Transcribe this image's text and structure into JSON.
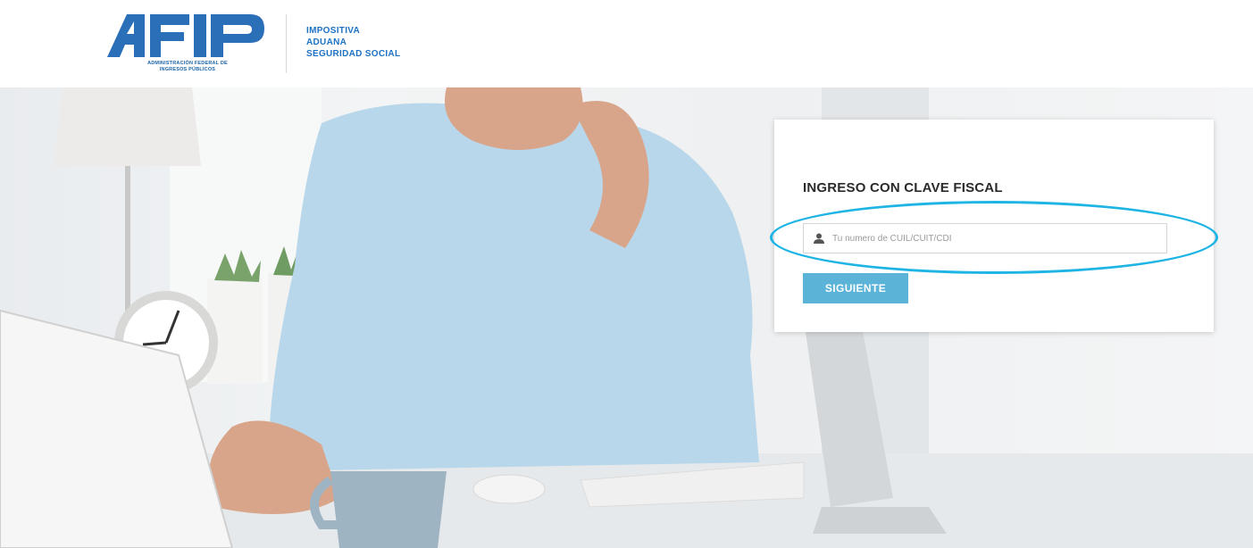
{
  "header": {
    "logo": {
      "wordmark": "AFIP",
      "caption_line1": "ADMINISTRACIÓN FEDERAL DE",
      "caption_line2": "INGRESOS PÚBLICOS"
    },
    "taxonomy": [
      "IMPOSITIVA",
      "ADUANA",
      "SEGURIDAD SOCIAL"
    ]
  },
  "login": {
    "title": "INGRESO CON CLAVE FISCAL",
    "cuit_placeholder": "Tu numero de CUIL/CUIT/CDI",
    "cuit_value": "",
    "next_label": "SIGUIENTE",
    "user_icon": "user-icon"
  },
  "colors": {
    "brand_blue": "#1e72c4",
    "button_blue": "#5bb4d8",
    "highlight": "#1eb4e4"
  }
}
